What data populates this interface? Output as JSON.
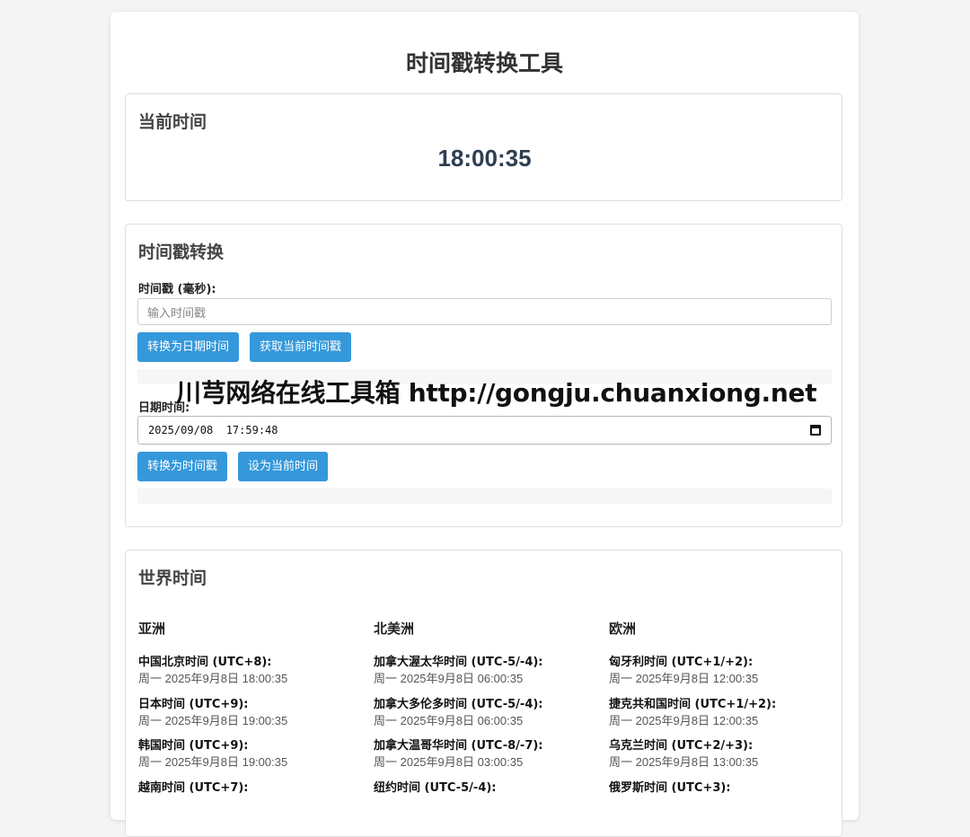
{
  "page_title": "时间戳转换工具",
  "current": {
    "title": "当前时间",
    "clock": "18:00:35"
  },
  "convert": {
    "title": "时间戳转换",
    "timestamp_label": "时间戳 (毫秒):",
    "timestamp_placeholder": "输入时间戳",
    "to_date_button": "转换为日期时间",
    "get_now_button": "获取当前时间戳",
    "datetime_label": "日期时间:",
    "datetime_value": "2025/09/08  17:59:48",
    "to_timestamp_button": "转换为时间戳",
    "set_now_button": "设为当前时间"
  },
  "watermark": "川芎网络在线工具箱 http://gongju.chuanxiong.net",
  "world": {
    "title": "世界时间",
    "regions": [
      {
        "name": "亚洲",
        "zones": [
          {
            "name": "中国北京时间 (UTC+8):",
            "time": "周一 2025年9月8日 18:00:35"
          },
          {
            "name": "日本时间 (UTC+9):",
            "time": "周一 2025年9月8日 19:00:35"
          },
          {
            "name": "韩国时间 (UTC+9):",
            "time": "周一 2025年9月8日 19:00:35"
          },
          {
            "name": "越南时间 (UTC+7):",
            "time": ""
          }
        ]
      },
      {
        "name": "北美洲",
        "zones": [
          {
            "name": "加拿大渥太华时间 (UTC-5/-4):",
            "time": "周一 2025年9月8日 06:00:35"
          },
          {
            "name": "加拿大多伦多时间 (UTC-5/-4):",
            "time": "周一 2025年9月8日 06:00:35"
          },
          {
            "name": "加拿大温哥华时间 (UTC-8/-7):",
            "time": "周一 2025年9月8日 03:00:35"
          },
          {
            "name": "纽约时间 (UTC-5/-4):",
            "time": ""
          }
        ]
      },
      {
        "name": "欧洲",
        "zones": [
          {
            "name": "匈牙利时间 (UTC+1/+2):",
            "time": "周一 2025年9月8日 12:00:35"
          },
          {
            "name": "捷克共和国时间 (UTC+1/+2):",
            "time": "周一 2025年9月8日 12:00:35"
          },
          {
            "name": "乌克兰时间 (UTC+2/+3):",
            "time": "周一 2025年9月8日 13:00:35"
          },
          {
            "name": "俄罗斯时间 (UTC+3):",
            "time": ""
          }
        ]
      }
    ]
  }
}
